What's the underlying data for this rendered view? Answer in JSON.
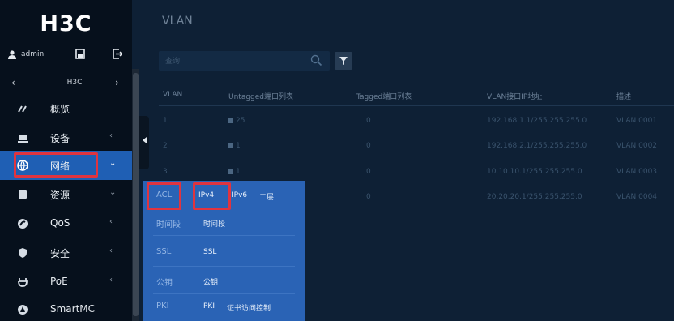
{
  "sidebar": {
    "brand": "H3C",
    "user": "admin",
    "device": "H3C",
    "nav": [
      {
        "label": "概览",
        "icon": "dashboard-icon",
        "chevron": ""
      },
      {
        "label": "设备",
        "icon": "device-icon",
        "chevron": "‹"
      },
      {
        "label": "网络",
        "icon": "globe-icon",
        "chevron": "⌄"
      },
      {
        "label": "资源",
        "icon": "database-icon",
        "chevron": "⌄"
      },
      {
        "label": "QoS",
        "icon": "qos-icon",
        "chevron": "‹"
      },
      {
        "label": "安全",
        "icon": "shield-icon",
        "chevron": "‹"
      },
      {
        "label": "PoE",
        "icon": "poe-icon",
        "chevron": "‹"
      },
      {
        "label": "SmartMC",
        "icon": "smartmc-icon",
        "chevron": ""
      }
    ]
  },
  "main": {
    "title": "VLAN",
    "search_placeholder": "查询",
    "columns": [
      "VLAN",
      "Untagged端口列表",
      "Tagged端口列表",
      "VLAN接口IP地址",
      "描述"
    ],
    "rows": [
      {
        "vlan": "1",
        "untagged": "25",
        "tagged": "0",
        "ip": "192.168.1.1/255.255.255.0",
        "desc": "VLAN 0001"
      },
      {
        "vlan": "2",
        "untagged": "1",
        "tagged": "0",
        "ip": "192.168.2.1/255.255.255.0",
        "desc": "VLAN 0002"
      },
      {
        "vlan": "3",
        "untagged": "1",
        "tagged": "0",
        "ip": "10.10.10.1/255.255.255.0",
        "desc": "VLAN 0003"
      },
      {
        "vlan": "",
        "untagged": "",
        "tagged": "0",
        "ip": "20.20.20.1/255.255.255.0",
        "desc": "VLAN 0004"
      }
    ]
  },
  "flyout": {
    "acl": {
      "category": "ACL",
      "items": [
        "IPv4",
        "IPv6",
        "二层"
      ]
    },
    "time": {
      "category": "时间段",
      "items": [
        "时间段"
      ]
    },
    "ssl": {
      "category": "SSL",
      "items": [
        "SSL"
      ]
    },
    "pubkey": {
      "category": "公钥",
      "items": [
        "公钥"
      ]
    },
    "pki": {
      "category": "PKI",
      "items": [
        "PKI",
        "证书访问控制"
      ]
    }
  },
  "colors": {
    "sidebar_bg": "#06101c",
    "main_bg": "#0e2035",
    "active_nav": "#1f5fb4",
    "flyout_bg": "#2a63b5",
    "highlight": "#e0343f"
  }
}
